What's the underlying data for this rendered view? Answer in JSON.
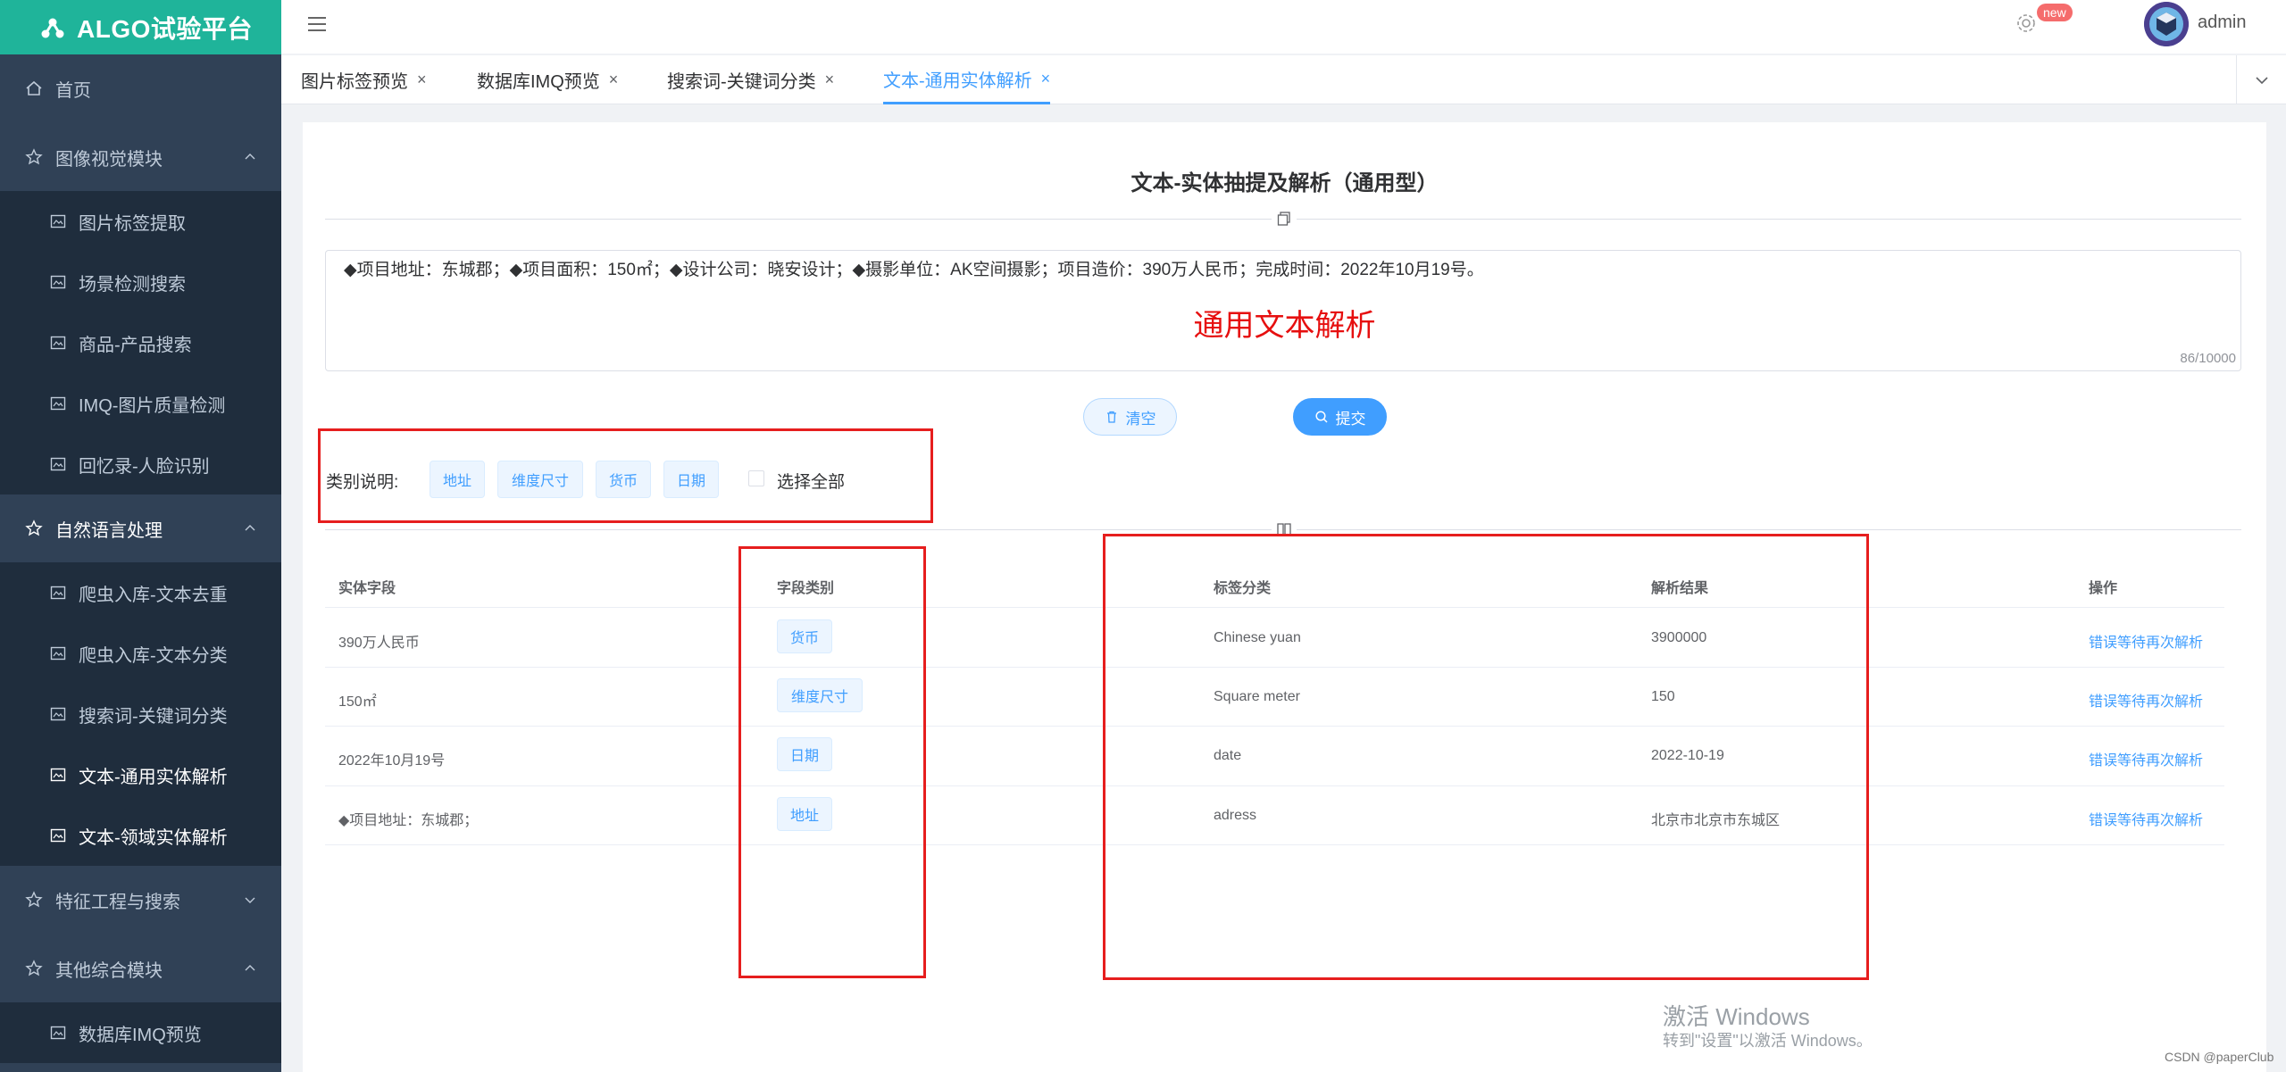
{
  "app": {
    "title": "ALGO试验平台"
  },
  "header": {
    "badge": "new",
    "username": "admin"
  },
  "sidebar": {
    "home": "首页",
    "group_vision": "图像视觉模块",
    "vision_items": [
      "图片标签提取",
      "场景检测搜索",
      "商品-产品搜索",
      "IMQ-图片质量检测",
      "回忆录-人脸识别"
    ],
    "group_nlp": "自然语言处理",
    "nlp_items": [
      "爬虫入库-文本去重",
      "爬虫入库-文本分类",
      "搜索词-关键词分类",
      "文本-通用实体解析",
      "文本-领域实体解析"
    ],
    "group_feature": "特征工程与搜索",
    "group_other": "其他综合模块",
    "other_items": [
      "数据库IMQ预览"
    ]
  },
  "tabs": [
    "图片标签预览",
    "数据库IMQ预览",
    "搜索词-关键词分类",
    "文本-通用实体解析"
  ],
  "main": {
    "title": "文本-实体抽提及解析（通用型）",
    "input_value": "◆项目地址：东城郡；◆项目面积：150㎡；◆设计公司：晓安设计；◆摄影单位：AK空间摄影；项目造价：390万人民币；完成时间：2022年10月19号。",
    "overlay_label": "通用文本解析",
    "char_count": "86/10000",
    "clear_label": "清空",
    "submit_label": "提交",
    "category_label": "类别说明:",
    "categories": [
      "地址",
      "维度尺寸",
      "货币",
      "日期"
    ],
    "select_all": "选择全部"
  },
  "table": {
    "headers": [
      "实体字段",
      "字段类别",
      "标签分类",
      "解析结果",
      "操作"
    ],
    "rows": [
      {
        "field": "390万人民币",
        "category": "货币",
        "label": "Chinese yuan",
        "result": "3900000",
        "action": "错误等待再次解析"
      },
      {
        "field": "150㎡",
        "category": "维度尺寸",
        "label": "Square meter",
        "result": "150",
        "action": "错误等待再次解析"
      },
      {
        "field": "2022年10月19号",
        "category": "日期",
        "label": "date",
        "result": "2022-10-19",
        "action": "错误等待再次解析"
      },
      {
        "field": "◆项目地址：东城郡；",
        "category": "地址",
        "label": "adress",
        "result": "北京市北京市东城区",
        "action": "错误等待再次解析"
      }
    ]
  },
  "watermark": {
    "line1": "激活 Windows",
    "line2": "转到\"设置\"以激活 Windows。",
    "credit": "CSDN @paperClub"
  },
  "colors": {
    "sidebar": "#304156",
    "logo_bg": "#1fb49a",
    "primary": "#409eff",
    "annotation": "#e61e1e"
  }
}
